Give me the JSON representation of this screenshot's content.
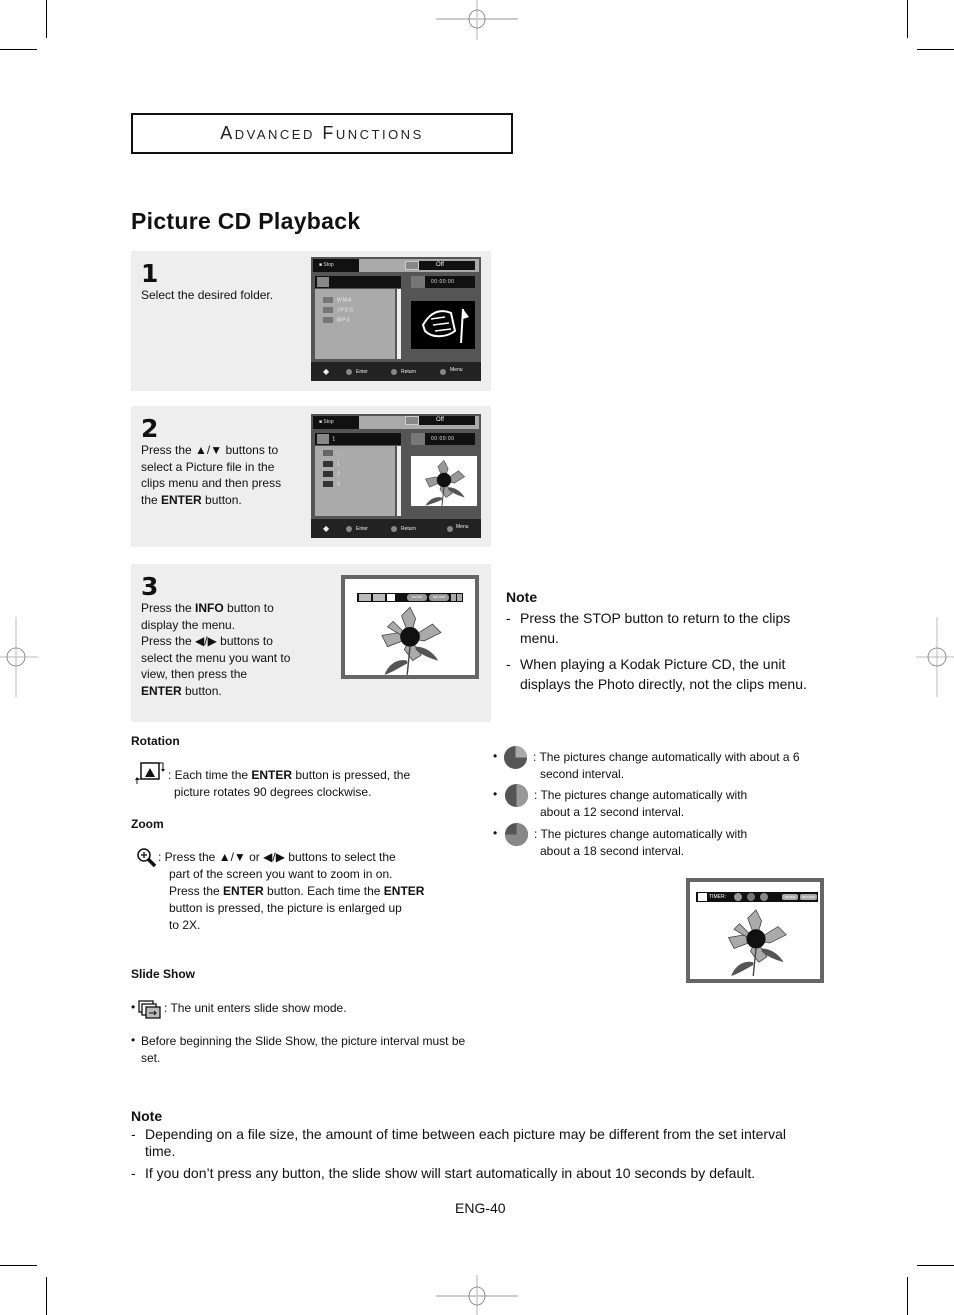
{
  "header": {
    "section_title": "Advanced Functions"
  },
  "page_title": "Picture CD Playback",
  "steps": [
    {
      "number": "1",
      "text": "Select the desired folder.",
      "osd": {
        "status": "Stop",
        "mode_value": "Off",
        "time": "00:00:00",
        "folders": [
          "WMA",
          "JPEG",
          "MP3"
        ],
        "buttons": {
          "enter": "Enter",
          "return": "Return",
          "menu": "Menu"
        }
      }
    },
    {
      "number": "2",
      "text_parts": {
        "a": "Press the ",
        "arrows": "▲/▼",
        "b": " buttons to select a Picture file in the clips menu and then press the ",
        "bold": "ENTER",
        "c": " button."
      },
      "osd": {
        "status": "Stop",
        "mode_value": "Off",
        "time": "00:00:00",
        "folder_label": "1",
        "parent_label": "...",
        "files": [
          "1",
          "2",
          "3"
        ],
        "buttons": {
          "enter": "Enter",
          "return": "Return",
          "menu": "Menu"
        }
      }
    },
    {
      "number": "3",
      "text_parts": {
        "a": "Press the ",
        "bold1": "INFO",
        "b": " button to display the menu.",
        "c": "Press the ",
        "arrows": "◀/▶",
        "d": " buttons to select the menu you want to view, then press the ",
        "bold2": "ENTER",
        "e": " button."
      },
      "infobar": {
        "enter": "ENTER",
        "return": "RETURN"
      }
    }
  ],
  "note_right": {
    "title": "Note",
    "items": [
      "Press the STOP button to return to the clips menu.",
      "When playing a Kodak Picture CD, the unit displays the Photo directly, not the clips menu."
    ]
  },
  "rotation": {
    "title": "Rotation",
    "text_a": ": Each time the ",
    "bold": "ENTER",
    "text_b": " button is pressed, the",
    "line2": "picture rotates 90 degrees clockwise."
  },
  "zoom": {
    "title": "Zoom",
    "line1_a": ": Press the ",
    "arrows1": "▲/▼",
    "or": " or ",
    "arrows2": "◀/▶",
    "line1_b": " buttons to select the",
    "line2": "part of the screen you want to zoom in on.",
    "line3_a": "Press the ",
    "bold1": "ENTER",
    "line3_b": " button. Each time the ",
    "bold2": "ENTER",
    "line4": "button is pressed, the picture is enlarged up",
    "line5": "to 2X."
  },
  "slideshow": {
    "title": "Slide Show",
    "item1": ": The unit enters slide show mode.",
    "item2_line1": "Before beginning the Slide Show, the picture interval must be",
    "item2_line2": "set."
  },
  "intervals": [
    {
      "seconds": 6,
      "line1": ": The pictures change automatically with about a 6",
      "line2": "second interval."
    },
    {
      "seconds": 12,
      "line1": ": The pictures change automatically with",
      "line2": "about a 12 second interval."
    },
    {
      "seconds": 18,
      "line1": ": The pictures change automatically with",
      "line2": "about a 18 second interval."
    }
  ],
  "timer_bar": {
    "label": "TIMER:",
    "enter": "ENTER",
    "return": "RETURN"
  },
  "note_bottom": {
    "title": "Note",
    "items": [
      {
        "line1": "Depending on a file size, the amount of time between each picture may be different from the set interval",
        "line2": "time."
      },
      {
        "line1": "If you don’t press any button, the slide show will start automatically in about 10 seconds by default."
      }
    ]
  },
  "page_number": "ENG-40",
  "bullet": "•",
  "dash": "-"
}
